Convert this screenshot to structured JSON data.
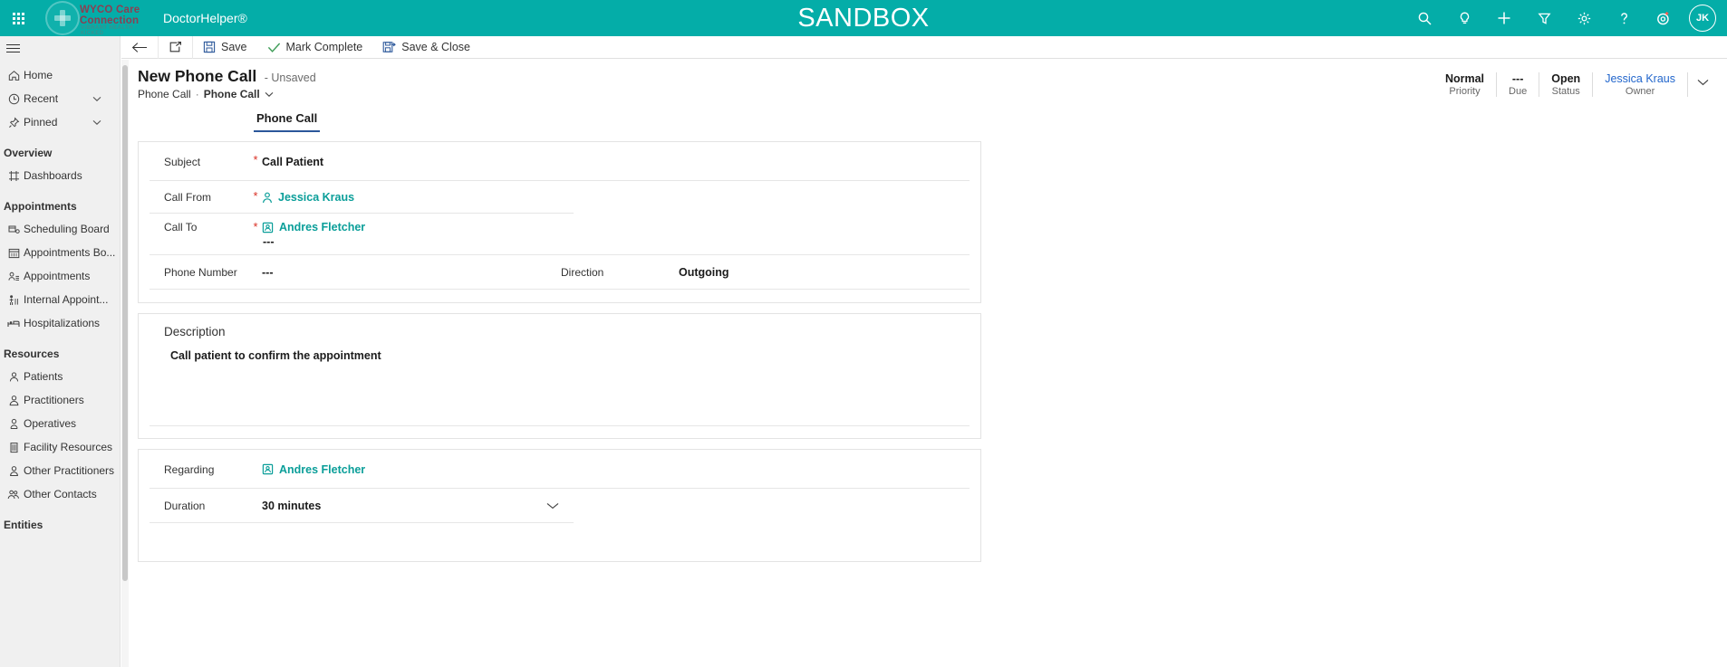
{
  "topbar": {
    "brand_line1": "WYCO Care",
    "brand_line2": "Connection",
    "brand_tagline": "VIBRANT HEALTH · KICKED",
    "app_name": "DoctorHelper®",
    "environment_banner": "SANDBOX",
    "accent_color": "#04ADA8",
    "icons": [
      {
        "name": "search-icon",
        "label": "Search"
      },
      {
        "name": "lightbulb-icon",
        "label": "Insights"
      },
      {
        "name": "plus-icon",
        "label": "Quick create"
      },
      {
        "name": "filter-icon",
        "label": "Filter"
      },
      {
        "name": "gear-icon",
        "label": "Settings"
      },
      {
        "name": "question-icon",
        "label": "Help"
      },
      {
        "name": "assistant-icon",
        "label": "Assistant"
      }
    ],
    "avatar_initials": "JK"
  },
  "sidebar": {
    "hamburger_label": "Site map",
    "items": [
      {
        "label": "Home",
        "icon": "home-icon",
        "chevron": false
      },
      {
        "label": "Recent",
        "icon": "clock-icon",
        "chevron": true
      },
      {
        "label": "Pinned",
        "icon": "pin-icon",
        "chevron": true
      }
    ],
    "groups": [
      {
        "title": "Overview",
        "items": [
          {
            "label": "Dashboards",
            "icon": "dashboard-icon"
          }
        ]
      },
      {
        "title": "Appointments",
        "items": [
          {
            "label": "Scheduling Board",
            "icon": "scheduling-board-icon"
          },
          {
            "label": "Appointments Bo...",
            "icon": "calendar-icon"
          },
          {
            "label": "Appointments",
            "icon": "appointments-icon"
          },
          {
            "label": "Internal Appoint...",
            "icon": "internal-appointment-icon"
          },
          {
            "label": "Hospitalizations",
            "icon": "bed-icon"
          }
        ]
      },
      {
        "title": "Resources",
        "items": [
          {
            "label": "Patients",
            "icon": "patient-icon"
          },
          {
            "label": "Practitioners",
            "icon": "practitioner-icon"
          },
          {
            "label": "Operatives",
            "icon": "operative-icon"
          },
          {
            "label": "Facility Resources",
            "icon": "building-icon"
          },
          {
            "label": "Other Practitioners",
            "icon": "other-practitioner-icon"
          },
          {
            "label": "Other Contacts",
            "icon": "other-contacts-icon"
          }
        ]
      },
      {
        "title": "Entities",
        "items": []
      }
    ]
  },
  "commandbar": {
    "back_label": "Back",
    "popout_label": "Open in new window",
    "save_label": "Save",
    "mark_complete_label": "Mark Complete",
    "save_close_label": "Save & Close"
  },
  "record": {
    "title": "New Phone Call",
    "state": "- Unsaved",
    "breadcrumb_entity": "Phone Call",
    "breadcrumb_sep": "·",
    "breadcrumb_form": "Phone Call",
    "tab_label": "Phone Call",
    "header_fields": [
      {
        "value": "Normal",
        "label": "Priority",
        "link": false
      },
      {
        "value": "---",
        "label": "Due",
        "link": false
      },
      {
        "value": "Open",
        "label": "Status",
        "link": false
      },
      {
        "value": "Jessica Kraus",
        "label": "Owner",
        "link": true
      }
    ]
  },
  "form": {
    "subject": {
      "label": "Subject",
      "value": "Call Patient",
      "required": true
    },
    "call_from": {
      "label": "Call From",
      "value": "Jessica Kraus",
      "required": true,
      "icon": "person-icon"
    },
    "call_to": {
      "label": "Call To",
      "value": "Andres Fletcher",
      "required": true,
      "icon": "contact-card-icon",
      "extra": "---"
    },
    "phone_number": {
      "label": "Phone Number",
      "value": "---",
      "required": false
    },
    "direction": {
      "label": "Direction",
      "value": "Outgoing",
      "required": false
    },
    "description": {
      "label": "Description",
      "value": "Call patient to confirm the appointment"
    },
    "regarding": {
      "label": "Regarding",
      "value": "Andres Fletcher",
      "icon": "contact-card-icon"
    },
    "duration": {
      "label": "Duration",
      "value": "30 minutes"
    }
  }
}
